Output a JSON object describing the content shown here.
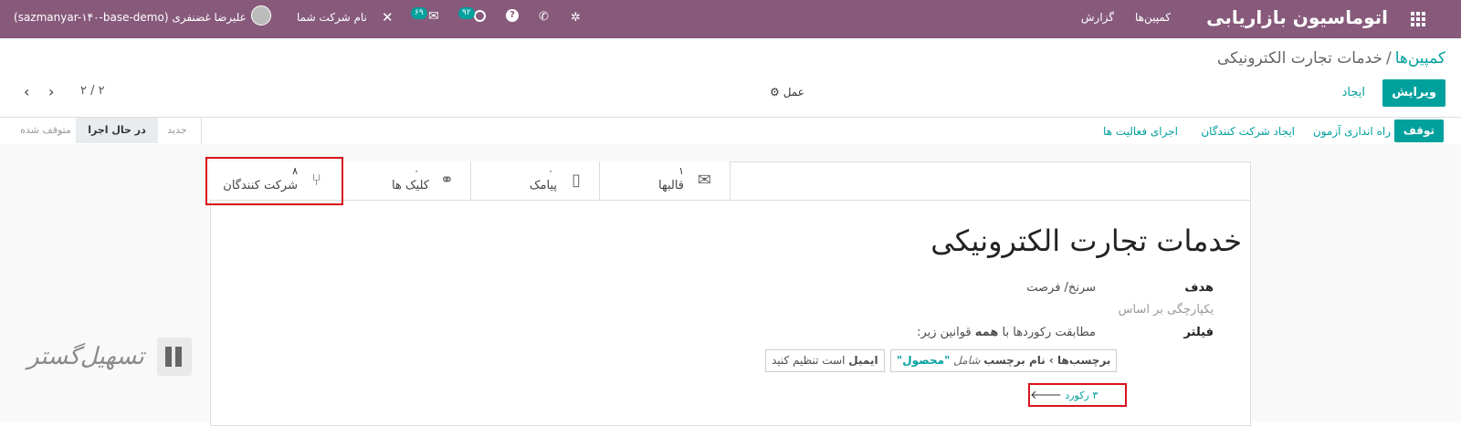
{
  "topbar": {
    "app_title": "اتوماسیون بازاریابی",
    "menu_campaigns": "کمپین‌ها",
    "menu_report": "گزارش",
    "company_name": "نام شرکت شما",
    "user_name": "علیرضا غضنفری (sazmanyar-۱۴۰-base-demo)",
    "activity_count": "۹۲",
    "messages_count": "۶۹",
    "bg_color": "#875a7b",
    "icons": [
      "apps-grid-icon",
      "bug-icon",
      "phone-icon",
      "help-icon",
      "clock-icon",
      "chat-icon",
      "close-icon",
      "avatar"
    ]
  },
  "breadcrumb": {
    "parent": "کمپین‌ها",
    "separator": "/",
    "current": "خدمات تجارت الکترونیکی"
  },
  "control": {
    "edit_label": "ویرایش",
    "create_label": "ایجاد",
    "action_label": "عمل",
    "pager": "۲ / ۲"
  },
  "statusbar": {
    "buttons": [
      "توقف",
      "راه اندازی آزمون",
      "ایجاد شرکت کنندگان",
      "اجرای فعالیت ها"
    ],
    "stages": [
      "جدید",
      "در حال اجرا",
      "متوقف شده"
    ],
    "active_stage": "در حال اجرا"
  },
  "smart_buttons": [
    {
      "num": "۱",
      "label": "قالبها",
      "icon": "envelope-icon"
    },
    {
      "num": "۰",
      "label": "پیامک",
      "icon": "mobile-icon"
    },
    {
      "num": "۰",
      "label": "کلیک ها",
      "icon": "link-icon"
    },
    {
      "num": "۸",
      "label": "شرکت کنندگان",
      "icon": "participants-icon"
    }
  ],
  "form": {
    "title": "خدمات تجارت الکترونیکی",
    "target_label": "هدف",
    "target_value": "سرنخ/ فرصت",
    "unique_label": "یکپارچگی بر اساس",
    "filter_label": "فیلتر",
    "filter_text_1": "مطابقت رکوردها با",
    "filter_text_bold": "همه",
    "filter_text_2": "قوانین زیر:",
    "rule1": {
      "field": "برچسب‌ها › نام برچسب",
      "op": "شامل",
      "value": "\"محصول\""
    },
    "rule2": {
      "field": "ایمیل",
      "op": "است تنظیم کنید"
    },
    "records": "۳ رکورد"
  },
  "watermark": "تسهیل‌گستر",
  "accent": "#00a09d"
}
